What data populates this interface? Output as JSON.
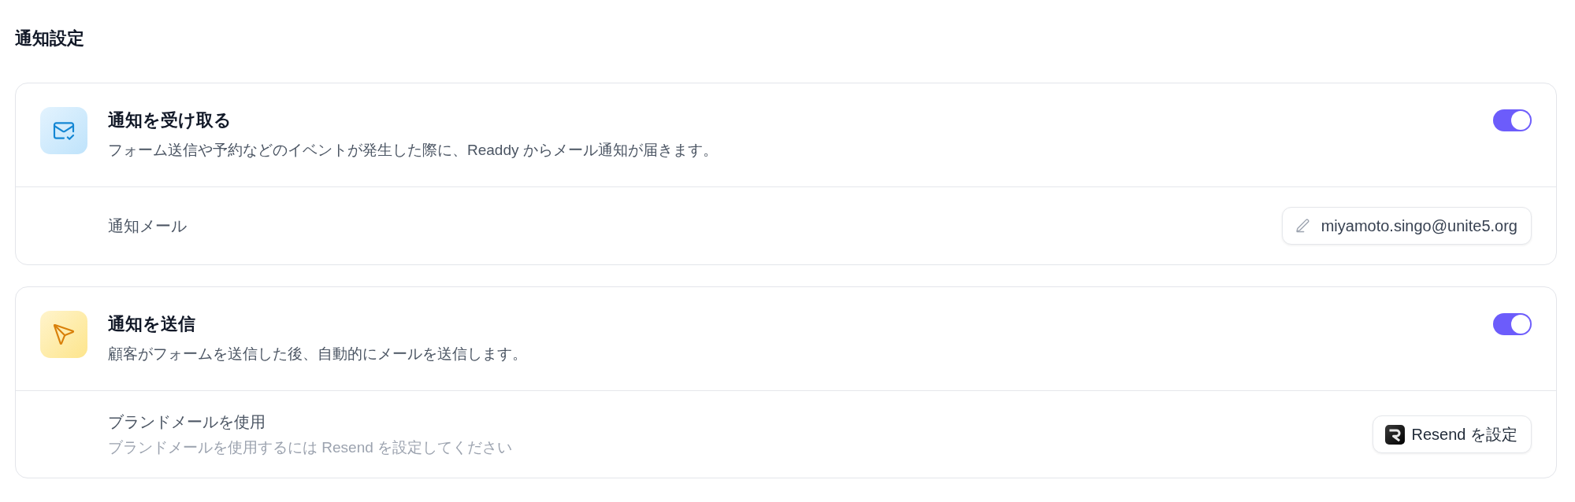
{
  "page": {
    "title": "通知設定"
  },
  "sections": [
    {
      "kind": "receive",
      "title": "通知を受け取る",
      "description": "フォーム送信や予約などのイベントが発生した際に、Readdy からメール通知が届きます。",
      "on": true,
      "setting": {
        "kind": "email",
        "label": "通知メール",
        "button": {
          "label": "miyamoto.singo@unite5.org"
        }
      }
    },
    {
      "kind": "send",
      "title": "通知を送信",
      "description": "顧客がフォームを送信した後、自動的にメールを送信します。",
      "on": true,
      "setting": {
        "kind": "brand",
        "label": "ブランドメールを使用",
        "hint": "ブランドメールを使用するには Resend を設定してください",
        "button": {
          "label": "Resend を設定"
        }
      }
    }
  ]
}
